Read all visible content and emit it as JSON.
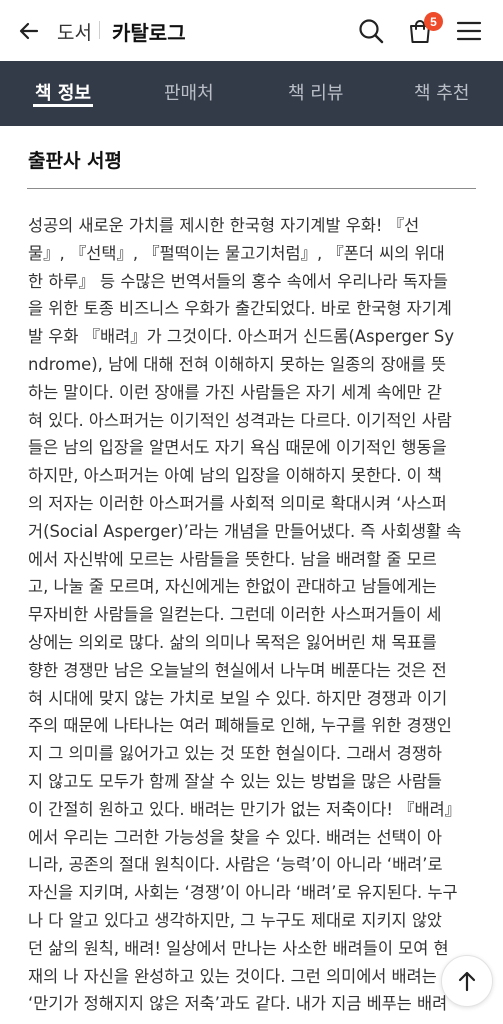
{
  "header": {
    "breadcrumb_parent": "도서",
    "breadcrumb_current": "카탈로그",
    "cart_count": "5"
  },
  "tabs": [
    {
      "label": "책 정보",
      "active": true
    },
    {
      "label": "판매처",
      "active": false
    },
    {
      "label": "책 리뷰",
      "active": false
    },
    {
      "label": "책 추천",
      "active": false
    }
  ],
  "section": {
    "title": "출판사 서평",
    "lines": [
      "성공의 새로운 가치를 제시한 한국형 자기계발 우화! 『선",
      "물』, 『선택』, 『펄떡이는 물고기처럼』, 『폰더 씨의 위대",
      "한 하루』 등 수많은 번역서들의 홍수 속에서 우리나라 독자들",
      "을 위한 토종 비즈니스 우화가 출간되었다. 바로 한국형 자기계",
      "발 우화 『배려』가 그것이다. 아스퍼거 신드롬(Asperger Sy",
      "ndrome), 남에 대해 전혀 이해하지 못하는 일종의 장애를 뜻",
      "하는 말이다. 이런 장애를 가진 사람들은 자기 세계 속에만 갇",
      "혀 있다. 아스퍼거는 이기적인 성격과는 다르다. 이기적인 사람",
      "들은 남의 입장을 알면서도 자기 욕심 때문에 이기적인 행동을",
      "하지만, 아스퍼거는 아예 남의 입장을 이해하지 못한다. 이 책",
      "의 저자는 이러한 아스퍼거를 사회적 의미로 확대시켜 ‘사스퍼",
      "거(Social Asperger)’라는 개념을 만들어냈다. 즉 사회생활 속",
      "에서 자신밖에 모르는 사람들을 뜻한다. 남을 배려할 줄 모르",
      "고, 나눌 줄 모르며, 자신에게는 한없이 관대하고 남들에게는",
      "무자비한 사람들을 일컫는다. 그런데 이러한 사스퍼거들이 세",
      "상에는 의외로 많다. 삶의 의미나 목적은 잃어버린 채 목표를",
      "향한 경쟁만 남은 오늘날의 현실에서 나누며 베푼다는 것은 전",
      "혀 시대에 맞지 않는 가치로 보일 수 있다. 하지만 경쟁과 이기",
      "주의 때문에 나타나는 여러 폐해들로 인해, 누구를 위한 경쟁인",
      "지 그 의미를 잃어가고 있는 것 또한 현실이다. 그래서 경쟁하",
      "지 않고도 모두가 함께 잘살 수 있는 있는 방법을 많은 사람들",
      "이 간절히 원하고 있다. 배려는 만기가 없는 저축이다! 『배려』",
      "에서 우리는 그러한 가능성을 찾을 수 있다. 배려는 선택이 아",
      "니라, 공존의 절대 원칙이다. 사람은 ‘능력’이 아니라 ‘배려’로",
      "자신을 지키며, 사회는 ‘경쟁’이 아니라 ‘배려’로 유지된다. 누구",
      "나 다 알고 있다고 생각하지만, 그 누구도 제대로 지키지 않았",
      "던 삶의 원칙, 배려! 일상에서 만나는 사소한 배려들이 모여 현",
      "재의 나 자신을 완성하고 있는 것이다. 그런 의미에서 배려는",
      "‘만기가 정해지지 않은 저축’과도 같다. 내가 지금 베푸는 배려"
    ]
  },
  "icons": {
    "back": "arrow-left-icon",
    "search": "search-icon",
    "cart": "shopping-bag-icon",
    "menu": "hamburger-menu-icon",
    "scroll_top": "arrow-up-icon"
  },
  "colors": {
    "tabbar_bg": "#333b48",
    "badge": "#ee4b2b"
  }
}
